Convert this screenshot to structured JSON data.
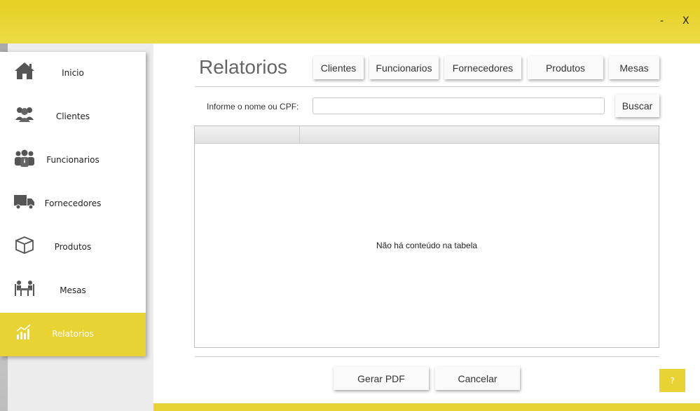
{
  "window": {
    "minimize": "-",
    "close": "X"
  },
  "sidebar": {
    "items": [
      {
        "label": "Inicio",
        "icon": "home-icon"
      },
      {
        "label": "Clientes",
        "icon": "users-icon"
      },
      {
        "label": "Funcionarios",
        "icon": "employees-icon"
      },
      {
        "label": "Fornecedores",
        "icon": "truck-icon"
      },
      {
        "label": "Produtos",
        "icon": "box-icon"
      },
      {
        "label": "Mesas",
        "icon": "tables-icon"
      },
      {
        "label": "Relatorios",
        "icon": "chart-icon"
      }
    ],
    "active": "Relatorios"
  },
  "main": {
    "title": "Relatorios",
    "tabs": [
      "Clientes",
      "Funcionarios",
      "Fornecedores",
      "Produtos",
      "Mesas"
    ],
    "search": {
      "label": "Informe o nome ou CPF:",
      "value": "",
      "placeholder": "",
      "button": "Buscar"
    },
    "table": {
      "columns": [
        "",
        ""
      ],
      "empty_message": "Não há conteúdo na tabela"
    },
    "actions": {
      "pdf": "Gerar PDF",
      "cancel": "Cancelar"
    },
    "help": "?"
  },
  "colors": {
    "accent": "#e8d234",
    "topbar": "#e6cf22"
  }
}
